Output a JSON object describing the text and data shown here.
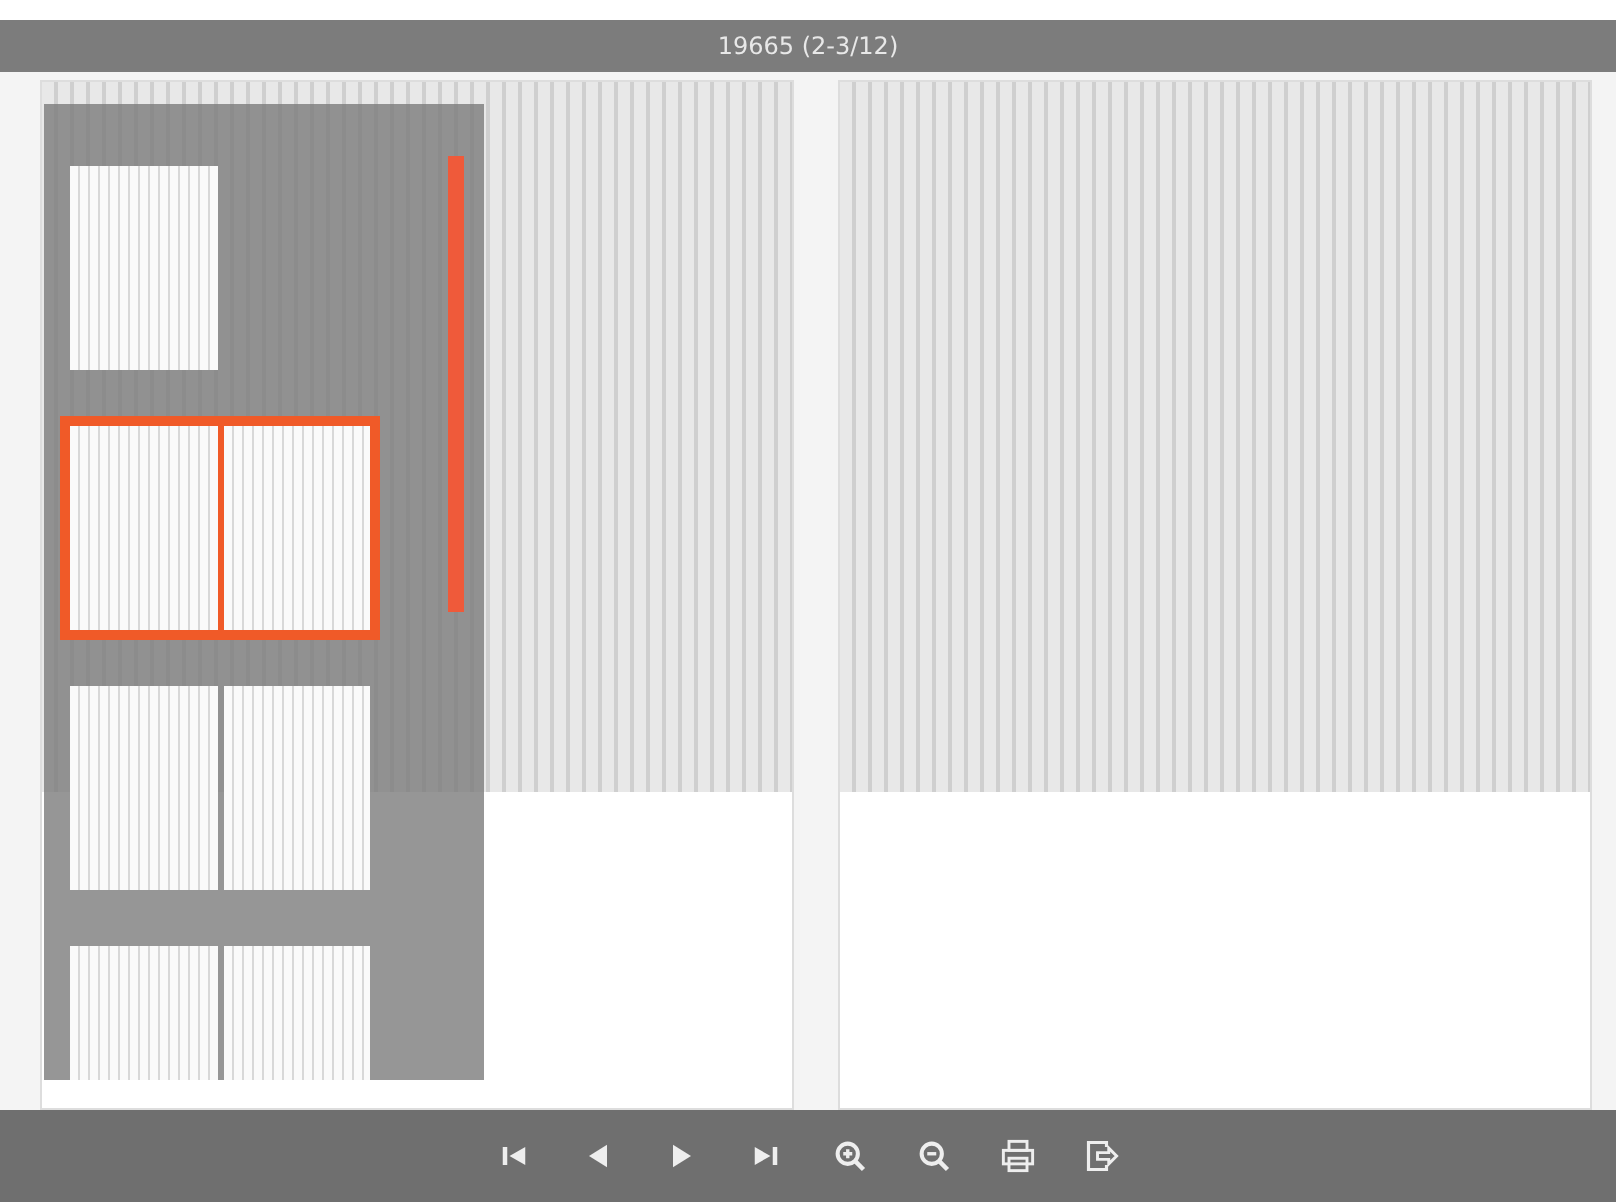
{
  "window": {
    "title": "19665 (2-3/12)"
  },
  "thumbnails": [
    {
      "kind": "single",
      "selected": false
    },
    {
      "kind": "spread",
      "selected": true
    },
    {
      "kind": "spread",
      "selected": false
    },
    {
      "kind": "spread",
      "selected": false
    }
  ],
  "toolbar": [
    {
      "kind": "first"
    },
    {
      "kind": "prev"
    },
    {
      "kind": "next"
    },
    {
      "kind": "last"
    },
    {
      "kind": "zoom-in"
    },
    {
      "kind": "zoom-out"
    },
    {
      "kind": "print"
    },
    {
      "kind": "export"
    }
  ]
}
